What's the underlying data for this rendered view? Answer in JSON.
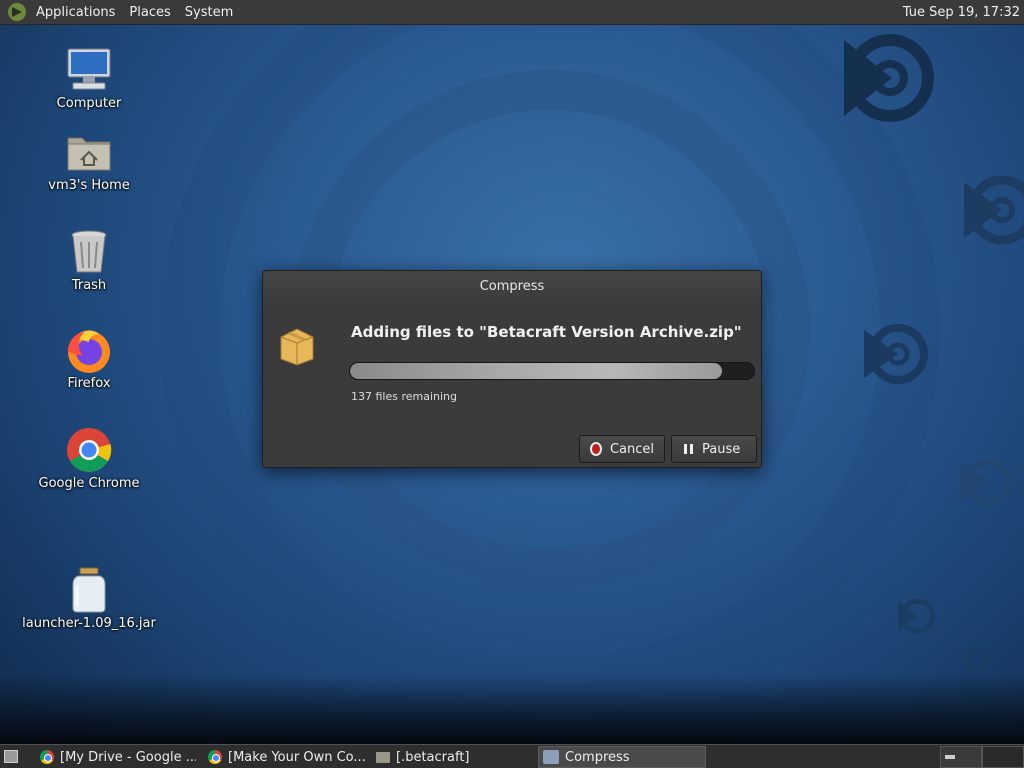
{
  "top_panel": {
    "menus": [
      "Applications",
      "Places",
      "System"
    ],
    "clock": "Tue Sep 19, 17:32"
  },
  "desktop": {
    "icons": [
      {
        "label": "Computer",
        "icon": "computer-icon"
      },
      {
        "label": "vm3's Home",
        "icon": "home-folder-icon"
      },
      {
        "label": "Trash",
        "icon": "trash-icon"
      },
      {
        "label": "Firefox",
        "icon": "firefox-icon"
      },
      {
        "label": "Google Chrome",
        "icon": "chrome-icon"
      },
      {
        "label": "launcher-1.09_16.jar",
        "icon": "jar-icon"
      }
    ]
  },
  "dialog": {
    "title": "Compress",
    "heading": "Adding files to \"Betacraft Version Archive.zip\"",
    "progress_fraction": 0.92,
    "remaining": "137 files remaining",
    "cancel_label": "Cancel",
    "pause_label": "Pause"
  },
  "taskbar": {
    "tasks": [
      {
        "label": "[My Drive - Google ...",
        "icon": "chrome-icon",
        "active": false
      },
      {
        "label": "[Make Your Own Co...",
        "icon": "chrome-icon",
        "active": false
      },
      {
        "label": "[.betacraft]",
        "icon": "folder-icon",
        "active": false
      },
      {
        "label": "Compress",
        "icon": "archive-icon",
        "active": true
      }
    ]
  }
}
